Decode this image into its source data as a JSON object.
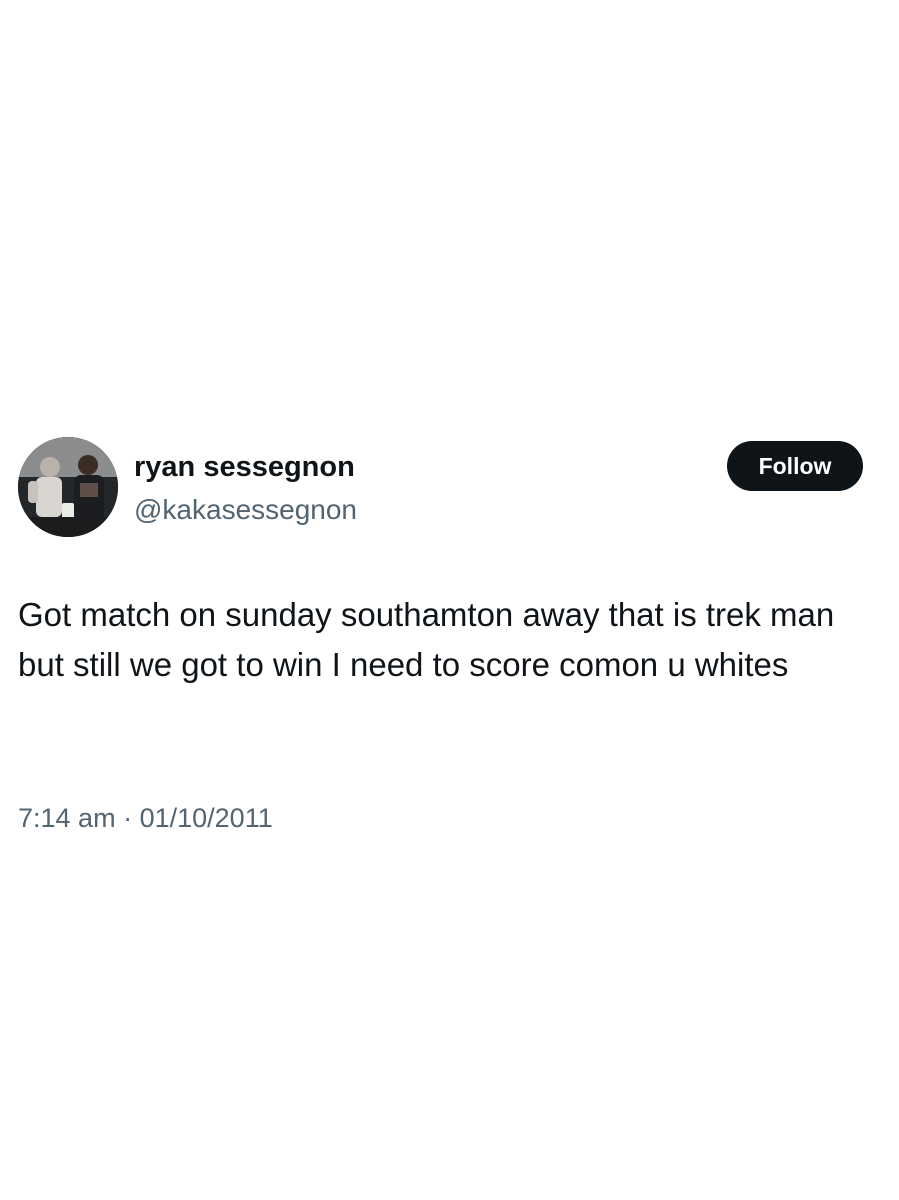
{
  "author": {
    "display_name": "ryan sessegnon",
    "handle": "@kakasessegnon",
    "avatar_icon": "profile-photo"
  },
  "follow_button": {
    "label": "Follow"
  },
  "tweet": {
    "text": "Got match on sunday southamton away that is trek man but still we got to win I need to score comon u whites",
    "time": "7:14 am",
    "separator": "·",
    "date": "01/10/2011"
  },
  "colors": {
    "text_primary": "#0f1419",
    "text_secondary": "#536471",
    "button_bg": "#0f1419",
    "button_text": "#ffffff",
    "background": "#ffffff"
  }
}
